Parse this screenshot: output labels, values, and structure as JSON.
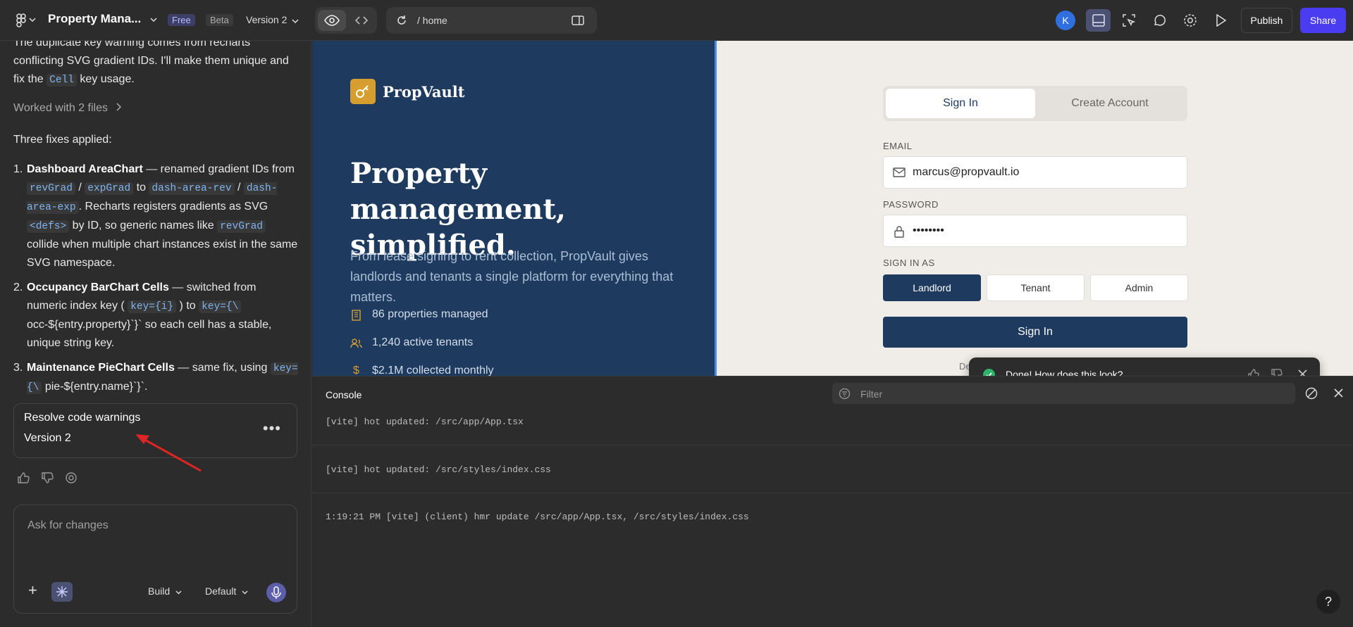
{
  "topbar": {
    "project_title": "Property Mana...",
    "badge_free": "Free",
    "badge_beta": "Beta",
    "version": "Version 2",
    "url_path": "/ home",
    "avatar_initial": "K",
    "publish": "Publish",
    "share": "Share"
  },
  "chat": {
    "intro_a": "The duplicate key warning comes from recharts conflicting SVG gradient IDs. I'll make them unique and fix the ",
    "intro_code": "Cell",
    "intro_b": " key usage.",
    "worked": "Worked with 2 files",
    "fixes_heading": "Three fixes applied:",
    "fix1": {
      "num": "1.",
      "title": "Dashboard AreaChart",
      "t1": " — renamed gradient IDs from ",
      "c1": "revGrad",
      "t2": " / ",
      "c2": "expGrad",
      "t3": " to ",
      "c3": "dash-area-rev",
      "t4": " / ",
      "c4": "dash-area-exp",
      "t5": ". Recharts registers gradients as SVG ",
      "c5": "<defs>",
      "t6": " by ID, so generic names like ",
      "c6": "revGrad",
      "t7": " collide when multiple chart instances exist in the same SVG namespace."
    },
    "fix2": {
      "num": "2.",
      "title": "Occupancy BarChart Cells",
      "t1": " — switched from numeric index key ( ",
      "c1": "key={i}",
      "t2": " ) to ",
      "c2": "key={\\",
      "t3": " occ-${entry.property}`}` so each cell has a stable, unique string key."
    },
    "fix3": {
      "num": "3.",
      "title": "Maintenance PieChart Cells",
      "t1": " — same fix, using ",
      "c1": "key={\\",
      "t2": " pie-${entry.name}`}`."
    },
    "version_card": {
      "title": "Resolve code warnings",
      "subtitle": "Version 2"
    },
    "input_placeholder": "Ask for changes",
    "mode": "Build",
    "model": "Default"
  },
  "preview": {
    "brand": "PropVault",
    "hero_title": "Property management, simplified.",
    "hero_sub": "From lease signing to rent collection, PropVault gives landlords and tenants a single platform for everything that matters.",
    "stats": [
      "86 properties managed",
      "1,240 active tenants",
      "$2.1M collected monthly"
    ],
    "tabs": {
      "signin": "Sign In",
      "create": "Create Account"
    },
    "email_label": "EMAIL",
    "email_value": "marcus@propvault.io",
    "password_label": "PASSWORD",
    "password_value": "••••••••",
    "signin_as_label": "SIGN IN AS",
    "roles": [
      "Landlord",
      "Tenant",
      "Admin"
    ],
    "signin_button": "Sign In",
    "demo_hint": "Demo: click a role above, then sign in",
    "toast": "Done! How does this look?"
  },
  "console": {
    "title": "Console",
    "filter_placeholder": "Filter",
    "logs": [
      "[vite] hot updated: /src/app/App.tsx",
      "[vite] hot updated: /src/styles/index.css",
      "1:19:21 PM [vite] (client) hmr update /src/app/App.tsx, /src/styles/index.css"
    ]
  },
  "help": "?",
  "colors": {
    "accent": "#4a3cf0",
    "navy": "#1e3a5f",
    "gold": "#d69e2e",
    "success": "#2eb36b"
  }
}
